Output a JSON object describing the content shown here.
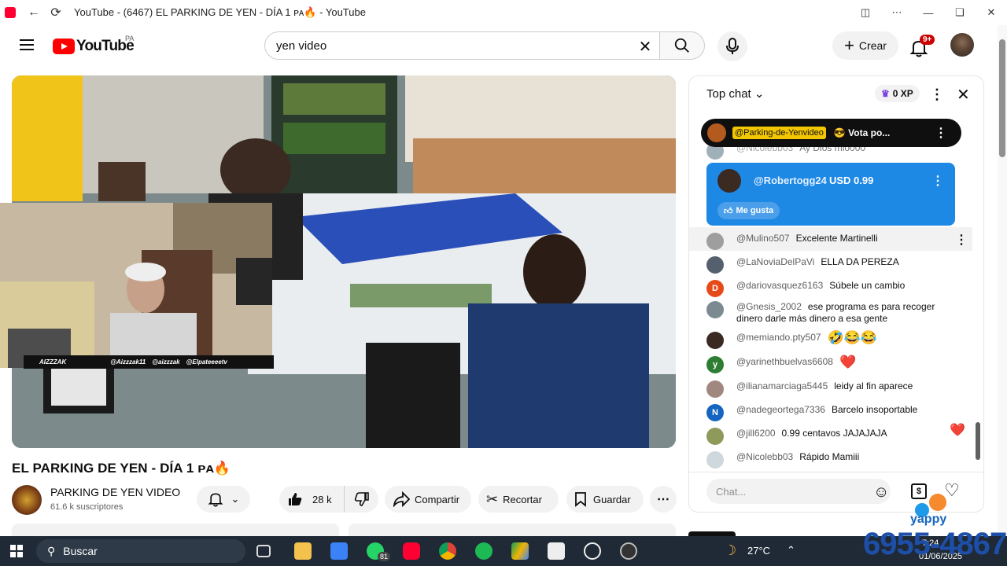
{
  "browser": {
    "window_title": "YouTube - (6467) EL PARKING DE YEN - DÍA 1 ᴘᴀ🔥 - YouTube"
  },
  "header": {
    "logo_text": "YouTube",
    "logo_country": "PA",
    "search_value": "yen video",
    "create_label": "Crear",
    "notifications_badge": "9+"
  },
  "video": {
    "title": "EL PARKING DE YEN - DÍA 1 ᴘᴀ🔥",
    "overlay_name": "AIZZZAK",
    "overlay_handle1": "@Aizzzak11",
    "overlay_handle2": "@aizzzak",
    "overlay_handle3": "@Elpateeeetv"
  },
  "channel": {
    "name": "PARKING DE YEN VIDEO",
    "subscribers": "61.6 k suscriptores"
  },
  "actions": {
    "likes": "28 k",
    "share": "Compartir",
    "clip": "Recortar",
    "save": "Guardar"
  },
  "chat": {
    "mode": "Top chat",
    "xp": "0 XP",
    "pinned_tag": "@Parking-de-Yenvideo",
    "pinned_text": "😎 Vota po...",
    "partial_author": "@Nicolebb03",
    "partial_text": "Ay Dios mio000",
    "superchat": {
      "author": "@Robertogg24",
      "amount": "USD 0.99",
      "like": "Me gusta"
    },
    "messages": [
      {
        "author": "@Mulino507",
        "text": "Excelente Martinelli",
        "avatar_color": "#9e9e9e",
        "initial": ""
      },
      {
        "author": "@LaNoviaDelPaVi",
        "text": "ELLA DA PEREZA",
        "avatar_color": "#55606e",
        "initial": ""
      },
      {
        "author": "@dariovasquez6163",
        "text": "Súbele un cambio",
        "avatar_color": "#e64a19",
        "initial": "D"
      },
      {
        "author": "@Gnesis_2002",
        "text": "ese programa es para recoger dinero darle más dinero a esa gente",
        "avatar_color": "#7a8a90",
        "initial": ""
      },
      {
        "author": "@memiando.pty507",
        "text": "🤣😂😂",
        "avatar_color": "#3a2a22",
        "initial": ""
      },
      {
        "author": "@yarinethbuelvas6608",
        "text": "❤️",
        "avatar_color": "#2e7d32",
        "initial": "y"
      },
      {
        "author": "@ilianamarciaga5445",
        "text": "leidy al fin aparece",
        "avatar_color": "#a1887f",
        "initial": ""
      },
      {
        "author": "@nadegeortega7336",
        "text": "Barcelo insoportable",
        "avatar_color": "#1565c0",
        "initial": "N"
      },
      {
        "author": "@jill6200",
        "text": "0.99 centavos JAJAJAJA",
        "avatar_color": "#8d9a5a",
        "initial": ""
      },
      {
        "author": "@Nicolebb03",
        "text": "Rápido Mamiii",
        "avatar_color": "#cfd8dc",
        "initial": ""
      }
    ],
    "input_placeholder": "Chat...",
    "heart_reaction": "❤️"
  },
  "taskbar": {
    "search_label": "Buscar",
    "whatsapp_badge": "81",
    "weather": "27°C",
    "time": "7:24",
    "date": "01/06/2025"
  },
  "yappy": {
    "label": "yappy",
    "phone": "6955-4867"
  }
}
